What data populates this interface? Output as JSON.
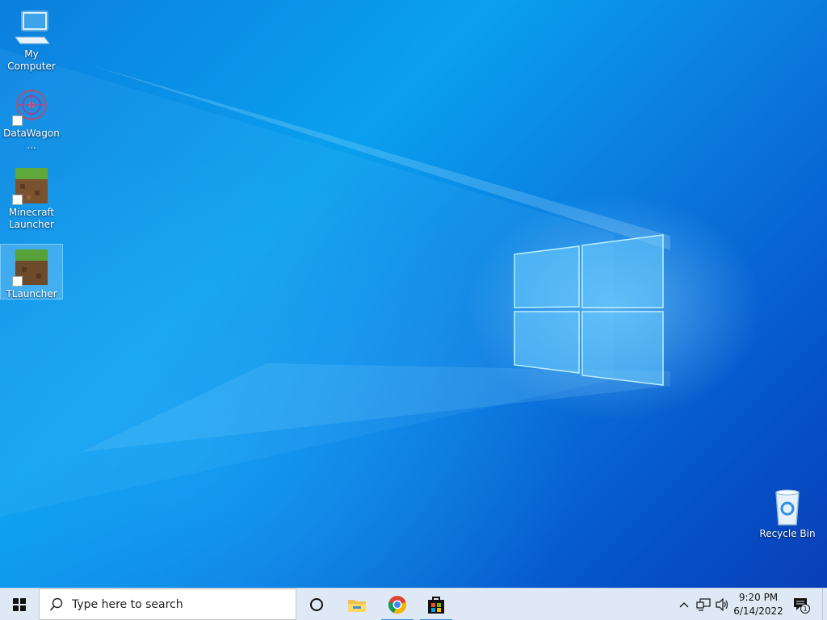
{
  "desktop": {
    "icons": [
      {
        "name": "my-computer",
        "label": "My Computer",
        "shortcut": false
      },
      {
        "name": "datawagon",
        "label": "DataWagon...",
        "shortcut": true
      },
      {
        "name": "minecraft-launcher",
        "label": "Minecraft Launcher",
        "shortcut": true
      },
      {
        "name": "tlauncher",
        "label": "TLauncher",
        "shortcut": true,
        "selected": true
      },
      {
        "name": "recycle-bin",
        "label": "Recycle Bin",
        "shortcut": false
      }
    ]
  },
  "taskbar": {
    "start_icon": "windows-logo-icon",
    "search_placeholder": "Type here to search",
    "pinned": [
      {
        "name": "cortana",
        "icon": "cortana-circle-icon",
        "active": false
      },
      {
        "name": "file-explorer",
        "icon": "folder-icon",
        "active": false
      },
      {
        "name": "chrome",
        "icon": "chrome-icon",
        "active": true
      },
      {
        "name": "store",
        "icon": "store-bag-icon",
        "active": true
      }
    ],
    "tray": {
      "time": "9:20 PM",
      "date": "6/14/2022",
      "notification_count": "1"
    }
  },
  "colors": {
    "taskbar_bg": "#dfe9f5",
    "accent": "#3a8ee6",
    "wallpaper_blue": "#0b7fde"
  }
}
